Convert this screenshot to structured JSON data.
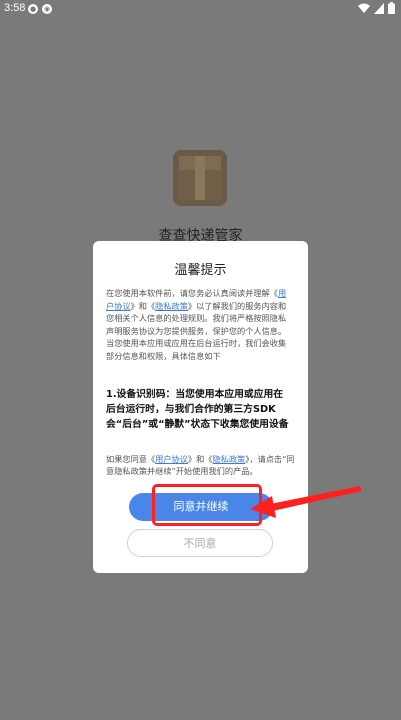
{
  "status_bar": {
    "time": "3:58",
    "left_icons": [
      "notification-dot-icon",
      "settings-dot-icon"
    ],
    "right_icons": [
      "wifi-icon",
      "signal-icon",
      "battery-icon"
    ]
  },
  "app": {
    "name": "查查快递管家",
    "icon": "package-box-icon"
  },
  "dialog": {
    "title": "温馨提示",
    "intro_text_1": "在您使用本软件前，请您务必认真阅读并理解《",
    "user_agreement_link": "用户协议",
    "intro_text_2": "》和《",
    "privacy_policy_link": "隐私政策",
    "intro_text_3": "》以了解我们的服务内容和您相关个人信息的处理规则。我们将严格按照隐私声明服务协议为您提供服务，保护您的个人信息。当您使用本应用或应用在后台运行时，我们会收集部分信息和权限，具体信息如下",
    "bold_section": "1.设备识别码：当您使用本应用或应用在后台运行时，与我们合作的第三方SDK会“后台”或“静默”状态下收集您使用设备的",
    "footer_text_1": "如果您同意《",
    "footer_user_agreement_link": "用户协议",
    "footer_text_2": "》和《",
    "footer_privacy_link": "隐私政策",
    "footer_text_3": "》，请点击“同意隐私政策并继续”开始使用我们的产品。",
    "agree_button": "同意并继续",
    "disagree_button": "不同意"
  },
  "annotation": {
    "highlight_color": "#ff2020"
  }
}
